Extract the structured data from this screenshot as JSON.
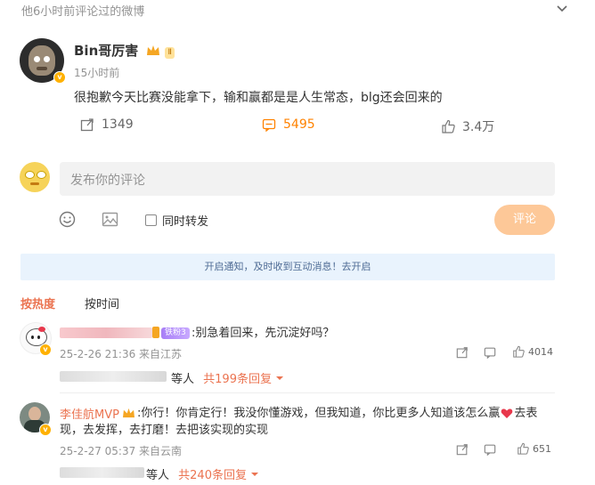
{
  "header": {
    "title": "他6小时前评论过的微博"
  },
  "post": {
    "author": "Bin哥厉害",
    "level_badge": "Ⅱ",
    "time": "15小时前",
    "text": "很抱歉今天比赛没能拿下，输和赢都是是人生常态，blg还会回来的",
    "reposts": "1349",
    "comments": "5495",
    "likes": "3.4万"
  },
  "composer": {
    "placeholder": "发布你的评论",
    "repost_label": "同时转发",
    "submit_label": "评论"
  },
  "notice": {
    "text": "开启通知，及时收到互动消息！去开启"
  },
  "sort_tabs": {
    "hot": "按热度",
    "time": "按时间"
  },
  "comments": [
    {
      "fan_badge": "铁粉3",
      "text": ":别急着回来，先沉淀好吗？",
      "meta": "25-2-26 21:36 来自江苏",
      "likes": "4014",
      "replies_suffix": "等人",
      "replies_count": "共199条回复"
    },
    {
      "author": "李佳航MVP",
      "text_line1": ":你行！你肯定行！我没你懂游戏，但我知道，你比更多人知道该怎么赢",
      "text_line1_tail": "去表",
      "text_line2": "现，去发挥，去打磨！去把该实现的实现",
      "meta": "25-2-27 05:37 来自云南",
      "likes": "651",
      "replies_suffix": "等人",
      "replies_count": "共240条回复"
    }
  ],
  "colors": {
    "accent": "#ff8200",
    "link": "#eb7350",
    "notice_bg": "#e9f3fd"
  }
}
